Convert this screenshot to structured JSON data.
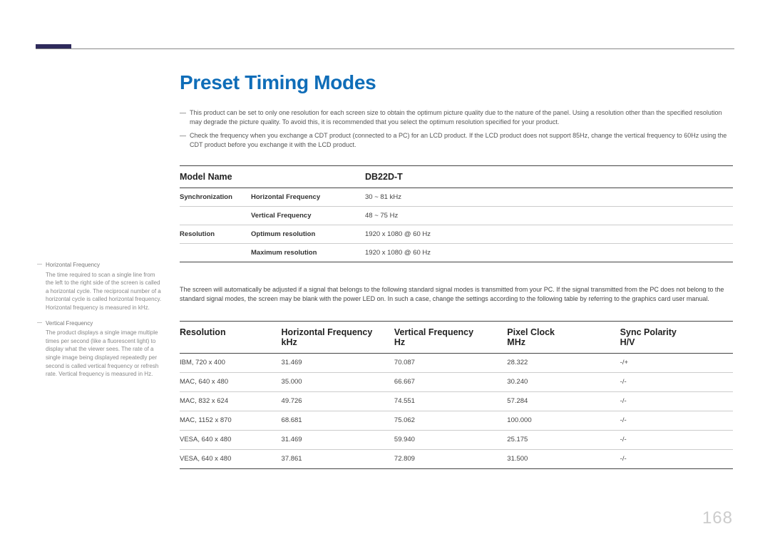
{
  "page_number": "168",
  "title": "Preset Timing Modes",
  "top_notes": [
    "This product can be set to only one resolution for each screen size to obtain the optimum picture quality due to the nature of the panel. Using a resolution other than the specified resolution may degrade the picture quality. To avoid this, it is recommended that you select the optimum resolution specified for your product.",
    "Check the frequency when you exchange a CDT product (connected to a PC) for an LCD product. If the LCD product does not support 85Hz, change the vertical frequency to 60Hz using the CDT product before you exchange it with the LCD product."
  ],
  "spec": {
    "headers": {
      "c1": "Model Name",
      "c2": "",
      "c3": "DB22D-T"
    },
    "rows": [
      {
        "c1": "Synchronization",
        "c2": "Horizontal Frequency",
        "c3": "30 ~ 81 kHz"
      },
      {
        "c1": "",
        "c2": "Vertical Frequency",
        "c3": "48 ~ 75 Hz"
      },
      {
        "c1": "Resolution",
        "c2": "Optimum resolution",
        "c3": "1920 x 1080 @ 60 Hz"
      },
      {
        "c1": "",
        "c2": "Maximum resolution",
        "c3": "1920 x 1080 @ 60 Hz"
      }
    ]
  },
  "mid_note": "The screen will automatically be adjusted if a signal that belongs to the following standard signal modes is transmitted from your PC. If the signal transmitted from the PC does not belong to the standard signal modes, the screen may be blank with the power LED on. In such a case, change the settings according to the following table by referring to the graphics card user manual.",
  "timing": {
    "headers": {
      "res": "Resolution",
      "hf": "Horizontal Frequency",
      "hf_unit": "kHz",
      "vf": "Vertical Frequency",
      "vf_unit": "Hz",
      "pc": "Pixel Clock",
      "pc_unit": "MHz",
      "sp": "Sync Polarity",
      "sp_unit": "H/V"
    },
    "rows": [
      {
        "res": "IBM, 720 x 400",
        "hf": "31.469",
        "vf": "70.087",
        "pc": "28.322",
        "sp": "-/+"
      },
      {
        "res": "MAC, 640 x 480",
        "hf": "35.000",
        "vf": "66.667",
        "pc": "30.240",
        "sp": "-/-"
      },
      {
        "res": "MAC, 832 x 624",
        "hf": "49.726",
        "vf": "74.551",
        "pc": "57.284",
        "sp": "-/-"
      },
      {
        "res": "MAC, 1152 x 870",
        "hf": "68.681",
        "vf": "75.062",
        "pc": "100.000",
        "sp": "-/-"
      },
      {
        "res": "VESA, 640 x 480",
        "hf": "31.469",
        "vf": "59.940",
        "pc": "25.175",
        "sp": "-/-"
      },
      {
        "res": "VESA, 640 x 480",
        "hf": "37.861",
        "vf": "72.809",
        "pc": "31.500",
        "sp": "-/-"
      }
    ]
  },
  "side_notes": [
    {
      "title": "Horizontal Frequency",
      "body": "The time required to scan a single line from the left to the right side of the screen is called a horizontal cycle. The reciprocal number of a horizontal cycle is called horizontal frequency. Horizontal frequency is measured in kHz."
    },
    {
      "title": "Vertical Frequency",
      "body": "The product displays a single image multiple times per second (like a fluorescent light) to display what the viewer sees. The rate of a single image being displayed repeatedly per second is called vertical frequency or refresh rate. Vertical frequency is measured in Hz."
    }
  ]
}
